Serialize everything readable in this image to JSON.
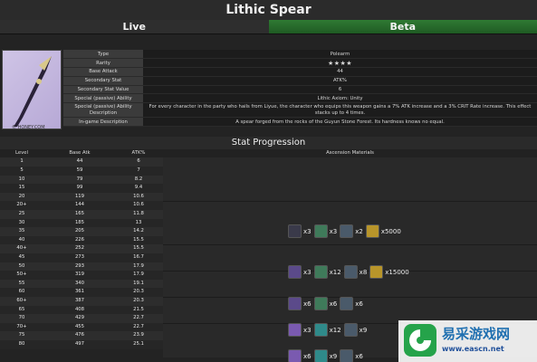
{
  "title": "Lithic Spear",
  "tabs": {
    "live": "Live",
    "beta": "Beta"
  },
  "image_watermark": "© HONEY.COM",
  "info": {
    "rows": [
      {
        "key": "Type",
        "value": "Polearm"
      },
      {
        "key": "Rarity",
        "value": "★★★★"
      },
      {
        "key": "Base Attack",
        "value": "44"
      },
      {
        "key": "Secondary Stat",
        "value": "ATK%"
      },
      {
        "key": "Secondary Stat Value",
        "value": "6"
      },
      {
        "key": "Special (passive) Ability",
        "value": "Lithic Axiom: Unity"
      },
      {
        "key": "Special (passive) Ability Description",
        "value": "For every character in the party who hails from Liyue, the character who equips this weapon gains a 7% ATK increase and a 3% CRIT Rate increase. This effect stacks up to 4 times."
      },
      {
        "key": "In-game Description",
        "value": "A spear forged from the rocks of the Guyun Stone Forest. Its hardness knows no equal."
      }
    ]
  },
  "progression": {
    "title": "Stat Progression",
    "headers": {
      "level": "Level",
      "atk": "Base Atk",
      "stat": "ATK%",
      "materials": "Ascension Materials"
    },
    "rows": [
      [
        "1",
        "44",
        "6"
      ],
      [
        "5",
        "59",
        "7"
      ],
      [
        "10",
        "79",
        "8.2"
      ],
      [
        "15",
        "99",
        "9.4"
      ],
      [
        "20",
        "119",
        "10.6"
      ],
      [
        "20+",
        "144",
        "10.6"
      ],
      [
        "25",
        "165",
        "11.8"
      ],
      [
        "30",
        "185",
        "13"
      ],
      [
        "35",
        "205",
        "14.2"
      ],
      [
        "40",
        "226",
        "15.5"
      ],
      [
        "40+",
        "252",
        "15.5"
      ],
      [
        "45",
        "273",
        "16.7"
      ],
      [
        "50",
        "293",
        "17.9"
      ],
      [
        "50+",
        "319",
        "17.9"
      ],
      [
        "55",
        "340",
        "19.1"
      ],
      [
        "60",
        "361",
        "20.3"
      ],
      [
        "60+",
        "387",
        "20.3"
      ],
      [
        "65",
        "408",
        "21.5"
      ],
      [
        "70",
        "429",
        "22.7"
      ],
      [
        "70+",
        "455",
        "22.7"
      ],
      [
        "75",
        "476",
        "23.9"
      ],
      [
        "80",
        "497",
        "25.1"
      ]
    ],
    "ascensions": [
      {
        "items": [
          {
            "icon": "dark-crystal-icon",
            "qty": "x3"
          },
          {
            "icon": "green-scroll-icon",
            "qty": "x3"
          },
          {
            "icon": "blade-fragment-icon",
            "qty": "x2"
          },
          {
            "icon": "mora-coin-icon",
            "qty": "x5000"
          }
        ]
      },
      {
        "items": [
          {
            "icon": "purple-crystal-icon",
            "qty": "x3"
          },
          {
            "icon": "green-scroll-icon",
            "qty": "x12"
          },
          {
            "icon": "blade-fragment-icon",
            "qty": "x8"
          },
          {
            "icon": "mora-coin-icon",
            "qty": "x15000"
          }
        ]
      },
      {
        "items": [
          {
            "icon": "purple-crystal-icon",
            "qty": "x6"
          },
          {
            "icon": "green-scroll-icon",
            "qty": "x6"
          },
          {
            "icon": "blade-fragment-icon",
            "qty": "x6"
          }
        ]
      },
      {
        "items": [
          {
            "icon": "violet-crystal-icon",
            "qty": "x3"
          },
          {
            "icon": "teal-scroll-icon",
            "qty": "x12"
          },
          {
            "icon": "blade-fragment-icon",
            "qty": "x9"
          }
        ]
      },
      {
        "items": [
          {
            "icon": "violet-crystal-icon",
            "qty": "x6"
          },
          {
            "icon": "teal-scroll-icon",
            "qty": "x9"
          },
          {
            "icon": "blade-fragment-icon",
            "qty": "x6"
          }
        ]
      }
    ]
  },
  "watermark": {
    "text": "易采游戏网",
    "url": "www.eascn.net"
  },
  "colors": {
    "accent_gold": "#d4a82a",
    "beta_green": "#2f7a33"
  }
}
